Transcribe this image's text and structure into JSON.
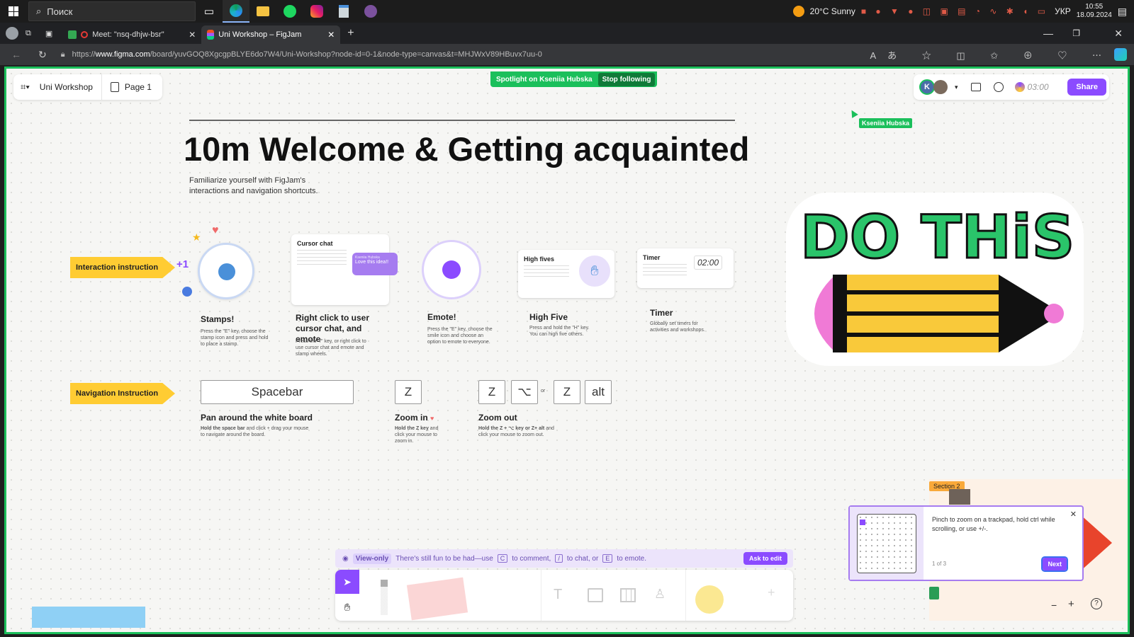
{
  "taskbar": {
    "search_placeholder": "Поиск",
    "weather": "20°C  Sunny",
    "lang": "УКР",
    "time": "10:55",
    "date": "18.09.2024"
  },
  "browser": {
    "tabs": [
      {
        "label": "Meet: \"nsq-dhjw-bsr\""
      },
      {
        "label": "Uni Workshop – FigJam"
      }
    ],
    "url_prefix": "https://",
    "url_domain": "www.figma.com",
    "url_rest": "/board/yuvGOQ8XgcgpBLYE6do7W4/Uni-Workshop?node-id=0-1&node-type=canvas&t=MHJWxV89HBuvx7uu-0"
  },
  "figjam": {
    "file_name": "Uni Workshop",
    "page_name": "Page 1",
    "spotlight_text": "Spotlight on Kseniia Hubska",
    "stop_following": "Stop following",
    "avatar_initial": "K",
    "timer": "03:00",
    "share": "Share",
    "cursor_name": "Kseniia Hubska"
  },
  "board": {
    "title": "10m Welcome & Getting acquainted",
    "subtitle": "Familiarize yourself with FigJam's interactions and navigation shortcuts.",
    "interaction_label": "Interaction instruction",
    "navigation_label": "Navigation Instruction",
    "cards": [
      {
        "title": "Stamps!",
        "desc": "Press the \"E\" key, choose the stamp icon and press and hold to place a stamp."
      },
      {
        "title": "Right click to user cursor chat, and emote",
        "desc": "Press the \"/\" key, or right click to use cursor chat and emote and stamp wheels."
      },
      {
        "title": "Emote!",
        "desc": "Press the \"E\" key, choose the smile icon and choose an option to emote to everyone."
      },
      {
        "title": "High Five",
        "desc": "Press and hold the \"H\" key. You can high five others."
      },
      {
        "title": "Timer",
        "desc": "Globally set timers for activities and workshops."
      }
    ],
    "cursor_chat_card": {
      "title": "Cursor chat",
      "bubble": "Love this idea!!",
      "bubble_name": "Kseniia Hubska"
    },
    "high_fives_card": {
      "title": "High fives"
    },
    "timer_card": {
      "title": "Timer",
      "value": "02:00"
    },
    "nav": [
      {
        "key": "Spacebar",
        "title": "Pan around the white board",
        "desc_bold": "Hold the space bar",
        "desc": " and click + drag your mouse to navigate around the board."
      },
      {
        "key": "Z",
        "title": "Zoom in",
        "desc_bold": "Hold the Z key",
        "desc": " and click your mouse to zoom in."
      },
      {
        "title": "Zoom out",
        "desc_bold": "Hold the Z + ⌥ key or Z+ alt",
        "desc": " and click your mouse to zoom out."
      }
    ],
    "zoomout_keys": [
      "Z",
      "⌥",
      "or",
      "Z",
      "alt"
    ],
    "sticker_text": "DO THiS"
  },
  "viewonly": {
    "label": "View-only",
    "text_a": "There's still fun to be had—use",
    "key_c": "C",
    "text_b": "to comment,",
    "key_slash": "/",
    "text_c": "to chat, or",
    "key_e": "E",
    "text_d": "to emote.",
    "ask": "Ask to edit"
  },
  "tip": {
    "text": "Pinch to zoom on a trackpad, hold ctrl while scrolling, or use +/-.",
    "count": "1 of 3",
    "next": "Next",
    "section": "Section 2"
  },
  "colors": {
    "accent": "#8b4bff",
    "figma_green": "#1bbf5b",
    "banner": "#ffcc33"
  }
}
